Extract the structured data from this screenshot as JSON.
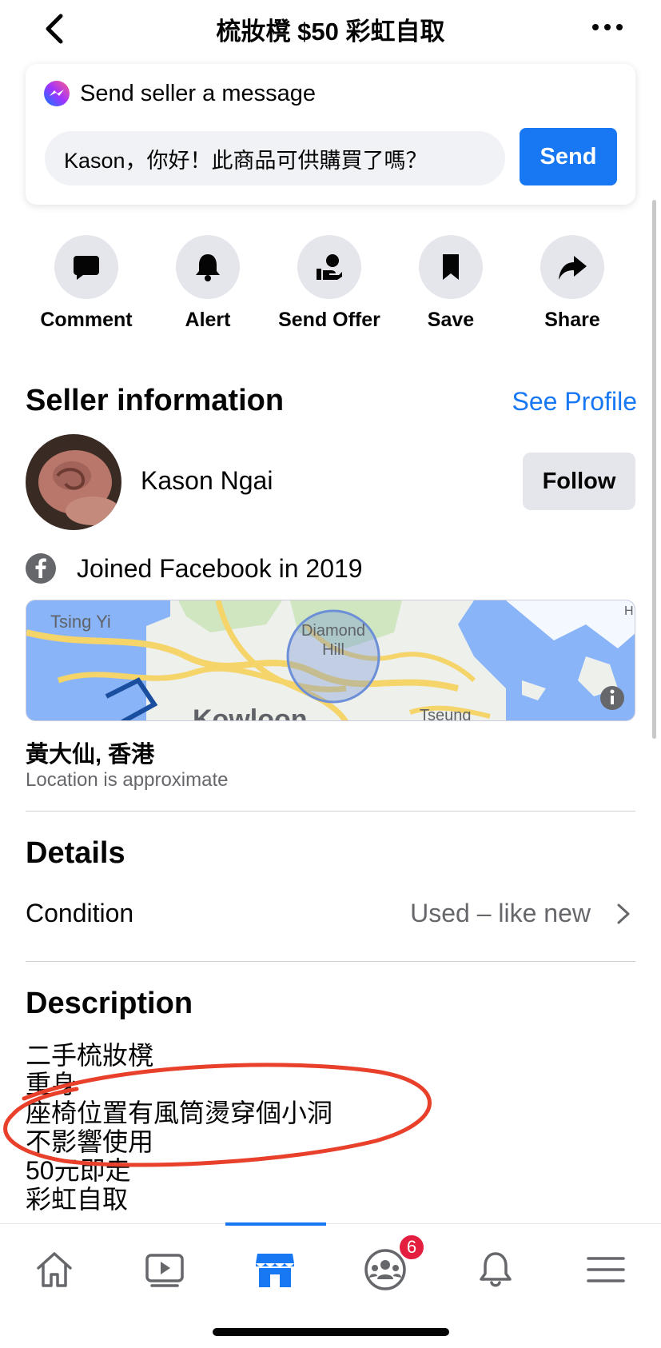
{
  "header": {
    "title": "梳妝櫈 $50 彩虹自取"
  },
  "message_card": {
    "heading": "Send seller a message",
    "input_value": "Kason，你好！此商品可供購買了嗎？",
    "send_label": "Send"
  },
  "actions": [
    {
      "label": "Comment",
      "icon": "comment-icon"
    },
    {
      "label": "Alert",
      "icon": "bell-icon"
    },
    {
      "label": "Send Offer",
      "icon": "offer-hand-icon"
    },
    {
      "label": "Save",
      "icon": "bookmark-icon"
    },
    {
      "label": "Share",
      "icon": "share-arrow-icon"
    }
  ],
  "seller": {
    "heading": "Seller information",
    "see_profile": "See Profile",
    "name": "Kason Ngai",
    "follow_label": "Follow",
    "joined": "Joined Facebook in 2019"
  },
  "map": {
    "labels": {
      "tsing_yi": "Tsing Yi",
      "diamond": "Diamond",
      "hill": "Hill",
      "kowloon": "Kowloon",
      "tseung": "Tseung",
      "edge": "H"
    }
  },
  "location": {
    "name": "黃大仙, 香港",
    "note": "Location is approximate"
  },
  "details": {
    "heading": "Details",
    "condition_label": "Condition",
    "condition_value": "Used – like new"
  },
  "description": {
    "heading": "Description",
    "lines": [
      "二手梳妝櫈",
      "重身",
      "座椅位置有風筒燙穿個小洞",
      "不影響使用",
      "50元即走",
      "彩虹自取"
    ]
  },
  "tabbar": {
    "tabs": [
      "home-icon",
      "video-icon",
      "marketplace-icon",
      "groups-icon",
      "notifications-icon",
      "menu-icon"
    ],
    "groups_badge": "6"
  },
  "colors": {
    "accent": "#1877f2",
    "badge": "#e41e3f",
    "annotation": "#e8402a"
  }
}
